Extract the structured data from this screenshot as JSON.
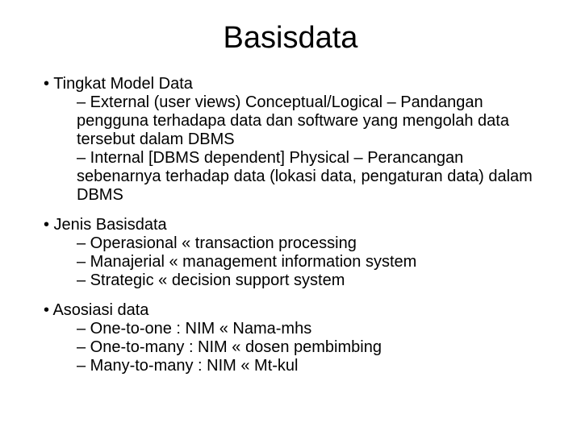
{
  "title": "Basisdata",
  "sections": [
    {
      "heading": "• Tingkat Model Data",
      "items": [
        "– External (user views) Conceptual/Logical – Pandangan pengguna terhadapa data dan software yang mengolah data tersebut dalam DBMS",
        "– Internal [DBMS dependent] Physical – Perancangan sebenarnya terhadap data (lokasi data, pengaturan data) dalam DBMS"
      ]
    },
    {
      "heading": "• Jenis Basisdata",
      "items": [
        "– Operasional « transaction processing",
        "– Manajerial « management information system",
        "– Strategic « decision support system"
      ]
    },
    {
      "heading": "• Asosiasi data",
      "items": [
        "– One-to-one : NIM « Nama-mhs",
        "– One-to-many : NIM « dosen pembimbing",
        "– Many-to-many :  NIM «  Mt-kul"
      ]
    }
  ]
}
